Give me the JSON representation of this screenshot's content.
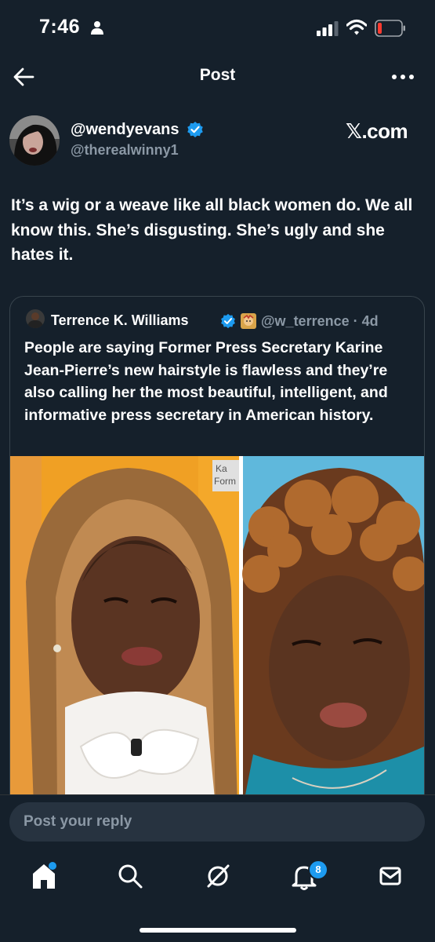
{
  "status_bar": {
    "time": "7:46",
    "icons": [
      "person-icon",
      "signal-icon",
      "wifi-icon",
      "battery-icon"
    ]
  },
  "header": {
    "title": "Post",
    "back_icon": "arrow-left-icon",
    "more_icon": "more-horizontal-icon"
  },
  "post": {
    "author_name": "@wendyevans",
    "author_handle": "@therealwinny1",
    "verified": true,
    "watermark": "𝕏.com",
    "text": "It’s a wig or a weave like all black women do. We all know this. She’s disgusting. She’s ugly and she hates it."
  },
  "quote": {
    "author_name": "Terrence K. Williams",
    "author_handle": "@w_terrence · 4d",
    "verified": true,
    "text": "People are saying Former Press Secretary Karine Jean-Pierre’s new hairstyle is flawless and they’re also calling her the most beautiful, intelligent, and informative press secretary in American history.",
    "media_overlay_text": [
      "Ka",
      "Form"
    ]
  },
  "reply": {
    "placeholder": "Post your reply"
  },
  "tab_bar": {
    "tabs": [
      "home-icon",
      "search-icon",
      "grok-icon",
      "notifications-icon",
      "messages-icon"
    ],
    "notification_count": "8"
  },
  "colors": {
    "background": "#15202b",
    "accent": "#1d9bf0",
    "secondary_text": "#8b98a5"
  }
}
